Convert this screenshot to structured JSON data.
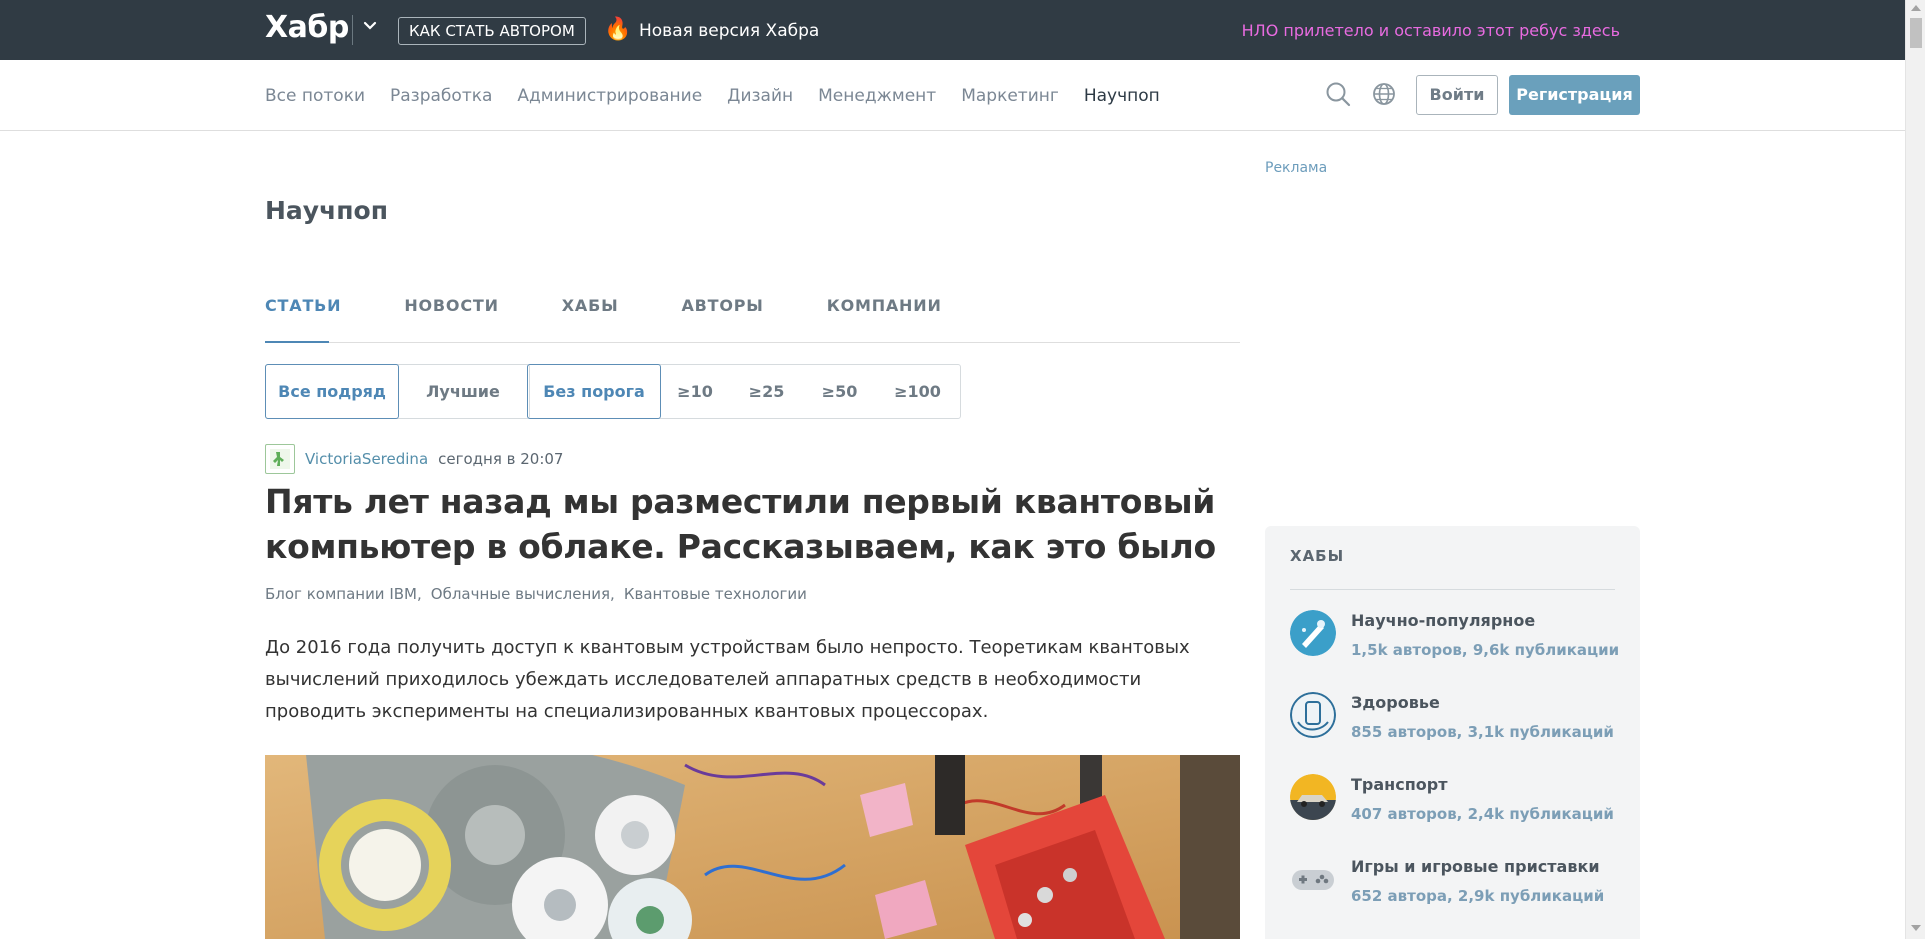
{
  "topbar": {
    "logo": "Хабр",
    "author_button": "КАК СТАТЬ АВТОРОМ",
    "fire_emoji": "🔥",
    "new_version": "Новая версия Хабра",
    "ufo_text": "НЛО прилетело и оставило этот ребус здесь"
  },
  "nav": {
    "flows": [
      "Все потоки",
      "Разработка",
      "Администрирование",
      "Дизайн",
      "Менеджмент",
      "Маркетинг",
      "Научпоп"
    ],
    "active_flow": "Научпоп",
    "login": "Войти",
    "register": "Регистрация"
  },
  "page": {
    "title": "Научпоп",
    "tabs": [
      "СТАТЬИ",
      "НОВОСТИ",
      "ХАБЫ",
      "АВТОРЫ",
      "КОМПАНИИ"
    ],
    "active_tab": "СТАТЬИ",
    "filter_type": [
      "Все подряд",
      "Лучшие"
    ],
    "filter_threshold": [
      "Без порога",
      "≥10",
      "≥25",
      "≥50",
      "≥100"
    ]
  },
  "post": {
    "author": "VictoriaSeredina",
    "time": "сегодня в 20:07",
    "title": "Пять лет назад мы разместили первый квантовый компьютер в облаке. Рассказываем, как это было",
    "hubs": [
      "Блог компании IBM,",
      "Облачные вычисления,",
      "Квантовые технологии"
    ],
    "lead": "До 2016 года получить доступ к квантовым устройствам было непросто. Теоретикам квантовых вычислений приходилось убеждать исследователей аппаратных средств в необходимости проводить эксперименты на специализированных квантовых процессорах."
  },
  "sidebar": {
    "ad_label": "Реклама",
    "hubs_title": "ХАБЫ",
    "hubs": [
      {
        "name": "Научно-популярное",
        "stats": "1,5k авторов, 9,6k публикации",
        "icon": "science-icon"
      },
      {
        "name": "Здоровье",
        "stats": "855 авторов, 3,1k публикаций",
        "icon": "health-icon"
      },
      {
        "name": "Транспорт",
        "stats": "407 авторов, 2,4k публикаций",
        "icon": "car-icon"
      },
      {
        "name": "Игры и игровые приставки",
        "stats": "652 автора, 2,9k публикаций",
        "icon": "gamepad-icon"
      }
    ]
  },
  "colors": {
    "topbar_bg": "#303b44",
    "accent": "#4e87b5",
    "register_bg": "#6aa0bc",
    "ufo": "#e86be0"
  }
}
